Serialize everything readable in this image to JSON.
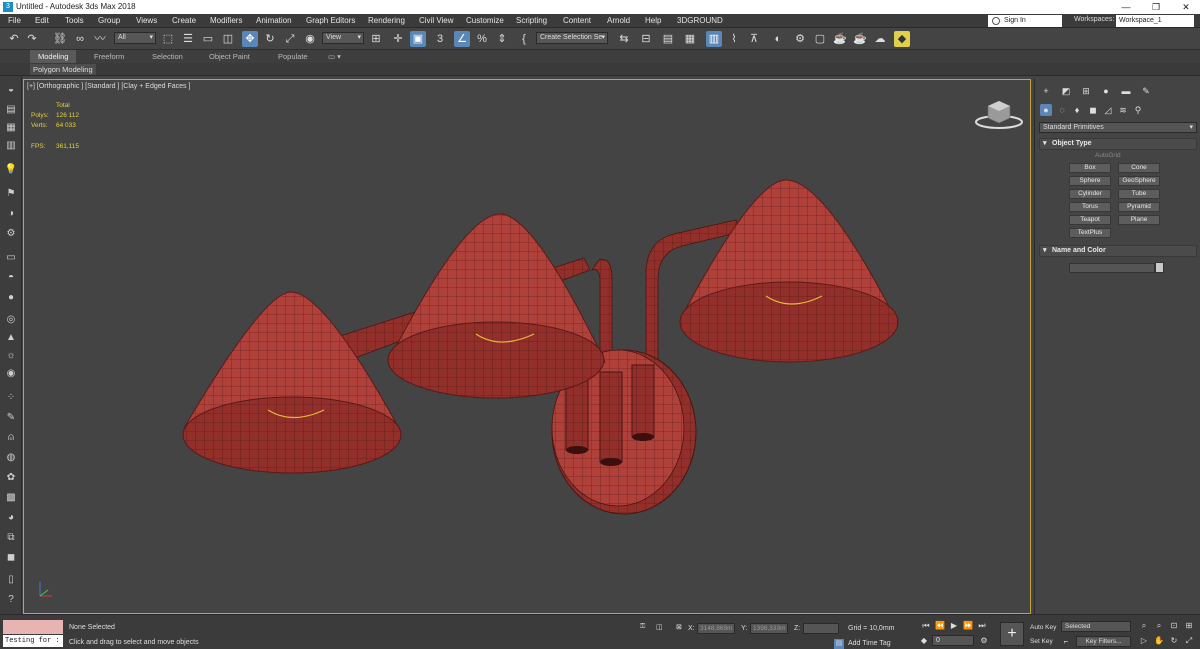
{
  "window": {
    "title": "Untitled - Autodesk 3ds Max 2018",
    "minimize": "—",
    "maximize": "❐",
    "close": "✕"
  },
  "menu": {
    "items": [
      "File",
      "Edit",
      "Tools",
      "Group",
      "Views",
      "Create",
      "Modifiers",
      "Animation",
      "Graph Editors",
      "Rendering",
      "Civil View",
      "Customize",
      "Scripting",
      "Content",
      "Arnold",
      "Help",
      "3DGROUND"
    ],
    "sign_in": "Sign In",
    "workspaces_label": "Workspaces:",
    "workspace_value": "Workspace_1"
  },
  "toolbar": {
    "selection_filter": "All",
    "ref_coord": "View",
    "selection_set": "Create Selection Se"
  },
  "ribbon": {
    "tabs": [
      "Modeling",
      "Freeform",
      "Selection",
      "Object Paint",
      "Populate"
    ],
    "active_tab": "Modeling",
    "sub_tab": "Polygon Modeling"
  },
  "viewport": {
    "label": "[+] [Orthographic ] [Standard ] [Clay + Edged Faces ]",
    "stats": {
      "total_label": "Total",
      "polys_label": "Polys:",
      "polys_value": "126 112",
      "verts_label": "Verts:",
      "verts_value": "64 033",
      "fps_label": "FPS:",
      "fps_value": "361,115"
    },
    "colors": {
      "mesh": "#b0403a",
      "mesh_dark": "#8f302c",
      "wire": "#5a1a17",
      "bulb": "#e3b93a",
      "border": "#c7a23a"
    }
  },
  "command_panel": {
    "category": "Standard Primitives",
    "object_type_title": "Object Type",
    "autogrid": "AutoGrid",
    "primitives": [
      "Box",
      "Cone",
      "Sphere",
      "GeoSphere",
      "Cylinder",
      "Tube",
      "Torus",
      "Pyramid",
      "Teapot",
      "Plane",
      "TextPlus"
    ],
    "name_color_title": "Name and Color"
  },
  "status": {
    "maxscript_text": "Testing for :",
    "selection": "None Selected",
    "prompt": "Click and drag to select and move objects",
    "x_label": "X:",
    "x_value": "3148,869m",
    "y_label": "Y:",
    "y_value": "1398,333m",
    "z_label": "Z:",
    "grid": "Grid = 10,0mm",
    "add_time_tag": "Add Time Tag",
    "frame": "0",
    "auto_key": "Auto Key",
    "set_key": "Set Key",
    "selected": "Selected",
    "key_filters": "Key Filters..."
  }
}
